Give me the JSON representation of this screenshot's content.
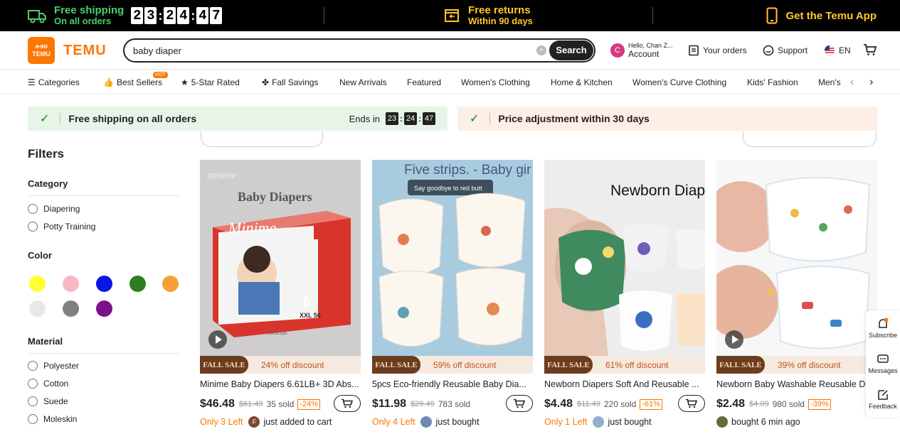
{
  "promo": {
    "shipping_line1": "Free shipping",
    "shipping_line2": "On all orders",
    "countdown": [
      "2",
      "3",
      "2",
      "4",
      "4",
      "7"
    ],
    "returns_line1": "Free returns",
    "returns_line2": "Within 90 days",
    "app_text": "Get the Temu App"
  },
  "header": {
    "logo_glyphs": "ɚɘɒ TEMU",
    "logo_text": "TEMU",
    "search_value": "baby diaper",
    "search_button": "Search",
    "account_initial": "C",
    "account_hello": "Hello, Chan Z...",
    "account_label": "Account",
    "orders": "Your orders",
    "support": "Support",
    "language": "EN"
  },
  "nav": {
    "categories": "Categories",
    "best_sellers": "Best Sellers",
    "hot": "HOT",
    "five_star": "5-Star Rated",
    "fall_savings": "Fall Savings",
    "new_arrivals": "New Arrivals",
    "featured": "Featured",
    "womens_clothing": "Women's Clothing",
    "home_kitchen": "Home & Kitchen",
    "womens_curve": "Women's Curve Clothing",
    "kids_fashion": "Kids' Fashion",
    "mens": "Men's"
  },
  "banners": {
    "shipping": "Free shipping on all orders",
    "ends_in": "Ends in",
    "ends_digits": [
      "23",
      "24",
      "47"
    ],
    "price_adjust": "Price adjustment within 30 days"
  },
  "filters": {
    "title": "Filters",
    "category_title": "Category",
    "categories": [
      "Diapering",
      "Potty Training"
    ],
    "color_title": "Color",
    "colors": [
      "#ffff33",
      "#f7b8c4",
      "#0a16e6",
      "#2e7d1e",
      "#f5a138",
      "#e8e8e8",
      "#808080",
      "#7a128a"
    ],
    "material_title": "Material",
    "materials": [
      "Polyester",
      "Cotton",
      "Suede",
      "Moleskin"
    ]
  },
  "products": [
    {
      "img_text": "Baby Diapers",
      "img_brand": "minime",
      "sale": "FALL SALE",
      "discount": "24% off discount",
      "title": "Minime Baby Diapers 6.61LB+ 3D Abs...",
      "price": "$46.48",
      "old_price": "$61.49",
      "sold": "35 sold",
      "pct": "-24%",
      "stock": "Only 3 Left",
      "activity_initial": "F",
      "activity": "just added to cart"
    },
    {
      "img_text": "Five strips. - Baby gir",
      "img_sub": "Say goodbye to red butt",
      "sale": "FALL SALE",
      "discount": "59% off discount",
      "title": "5pcs Eco-friendly Reusable Baby Dia...",
      "price": "$11.98",
      "old_price": "$29.49",
      "sold": "783 sold",
      "stock": "Only 4 Left",
      "activity": "just bought"
    },
    {
      "img_text": "Newborn Diap",
      "sale": "FALL SALE",
      "discount": "61% off discount",
      "title": "Newborn Diapers Soft And Reusable ...",
      "price": "$4.48",
      "old_price": "$11.49",
      "sold": "220 sold",
      "pct": "-61%",
      "stock": "Only 1 Left",
      "activity": "just bought"
    },
    {
      "sale": "FALL SALE",
      "discount": "39% off discount",
      "title": "Newborn Baby Washable Reusable D...",
      "price": "$2.48",
      "old_price": "$4.09",
      "sold": "980 sold",
      "pct": "-39%",
      "activity": "bought 6 min ago"
    }
  ],
  "side": {
    "subscribe": "Subscribe",
    "messages": "Messages",
    "feedback": "Feedback"
  }
}
